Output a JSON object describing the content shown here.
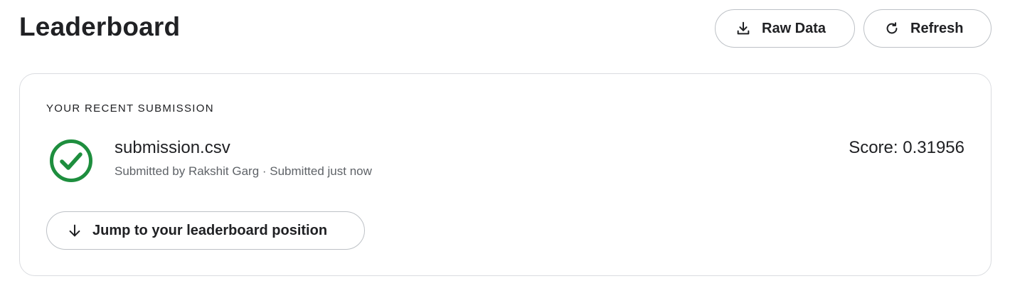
{
  "header": {
    "title": "Leaderboard",
    "raw_data_label": "Raw Data",
    "refresh_label": "Refresh"
  },
  "submission": {
    "heading": "YOUR RECENT SUBMISSION",
    "file_name": "submission.csv",
    "submitted_by": "Submitted by Rakshit Garg · Submitted just now",
    "score": "Score: 0.31956",
    "status_icon": "check-circle-icon",
    "status_color": "#1e8e3e",
    "jump_label": "Jump to your leaderboard position"
  },
  "icons": {
    "raw_data": "download-icon",
    "refresh": "refresh-icon",
    "jump": "arrow-down-icon"
  }
}
